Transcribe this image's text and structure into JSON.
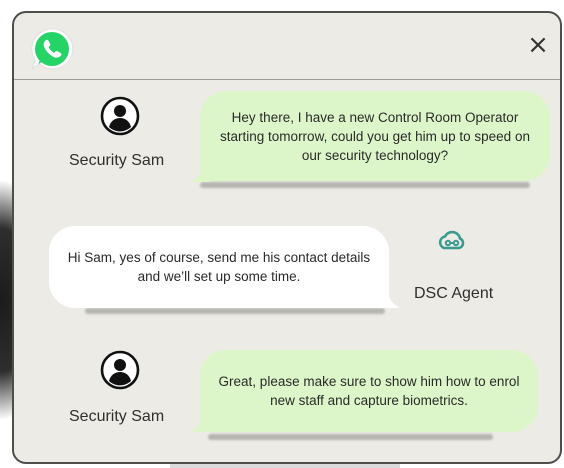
{
  "window": {
    "close_label": "×"
  },
  "colors": {
    "window_bg": "#ecebe5",
    "green_bubble": "#ddf6c9",
    "white_bubble": "#ffffff",
    "whatsapp_green": "#25d366",
    "agent_logo": "#3a9a8f"
  },
  "icons": {
    "app": "whatsapp-icon",
    "user_avatar": "user-avatar-icon",
    "agent_avatar": "cloud-network-icon",
    "close": "close-icon"
  },
  "messages": [
    {
      "sender": "Security Sam",
      "text": "Hey there, I have a new Control Room Operator starting tomorrow, could you get him up to speed on our security technology?"
    },
    {
      "sender": "DSC Agent",
      "text": "Hi Sam, yes of course, send me his contact details and we’ll set up some time."
    },
    {
      "sender": "Security Sam",
      "text": "Great, please make sure to show him how to enrol new staff and capture biometrics."
    }
  ]
}
